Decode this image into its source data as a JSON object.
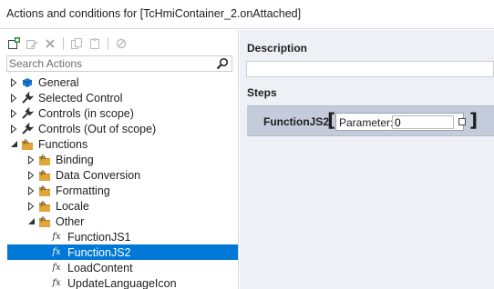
{
  "window": {
    "title": "Actions and conditions for [TcHmiContainer_2.onAttached]"
  },
  "toolbar": {
    "buttons": [
      {
        "icon": "add-icon",
        "enabled": true
      },
      {
        "icon": "edit-icon",
        "enabled": false
      },
      {
        "icon": "delete-icon",
        "enabled": false
      },
      {
        "icon": "copy-icon",
        "enabled": false
      },
      {
        "icon": "paste-icon",
        "enabled": false
      },
      {
        "icon": "link-icon",
        "enabled": false
      }
    ]
  },
  "search": {
    "placeholder": "Search Actions"
  },
  "tree": {
    "general": "General",
    "selected_control": "Selected Control",
    "controls_in_scope": "Controls (in scope)",
    "controls_out_scope": "Controls (Out of scope)",
    "functions": "Functions",
    "binding": "Binding",
    "data_conversion": "Data Conversion",
    "formatting": "Formatting",
    "locale": "Locale",
    "other": "Other",
    "function_js1": "FunctionJS1",
    "function_js2": "FunctionJS2",
    "load_content": "LoadContent",
    "update_language_icon": "UpdateLanguageIcon",
    "fx_symbol": "fx"
  },
  "right": {
    "description_label": "Description",
    "description_value": "",
    "steps_label": "Steps",
    "step": {
      "name": "FunctionJS2",
      "open_bracket": "[",
      "close_bracket": "]",
      "parameter_label": "Parameter:",
      "parameter_value": "0"
    }
  },
  "colors": {
    "selection": "#0078d7",
    "pane_bg": "#eef0f6",
    "step_bg": "#c4cbda"
  }
}
